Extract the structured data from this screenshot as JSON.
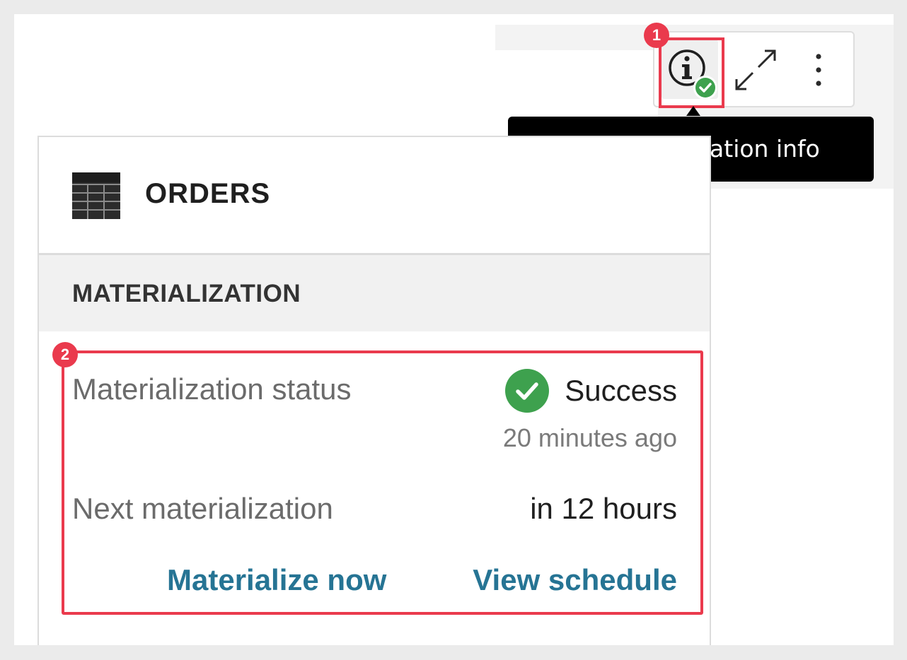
{
  "toolbar": {
    "info_icon": "info-icon",
    "status_badge_icon": "check-circle-icon",
    "expand_icon": "expand-icon",
    "more_icon": "more-vertical-icon",
    "status_color": "#3ea14e"
  },
  "tooltip": {
    "text": "View materialization info"
  },
  "callouts": [
    "1",
    "2"
  ],
  "card": {
    "icon": "table-icon",
    "title": "ORDERS",
    "section_title": "MATERIALIZATION",
    "status_label": "Materialization status",
    "status_value": "Success",
    "status_icon": "check-circle-icon",
    "status_time": "20 minutes ago",
    "next_label": "Next materialization",
    "next_value": "in 12 hours",
    "actions": {
      "materialize_now": "Materialize now",
      "view_schedule": "View schedule"
    },
    "link_color": "#267494"
  },
  "highlight_color": "#ea3a4d"
}
